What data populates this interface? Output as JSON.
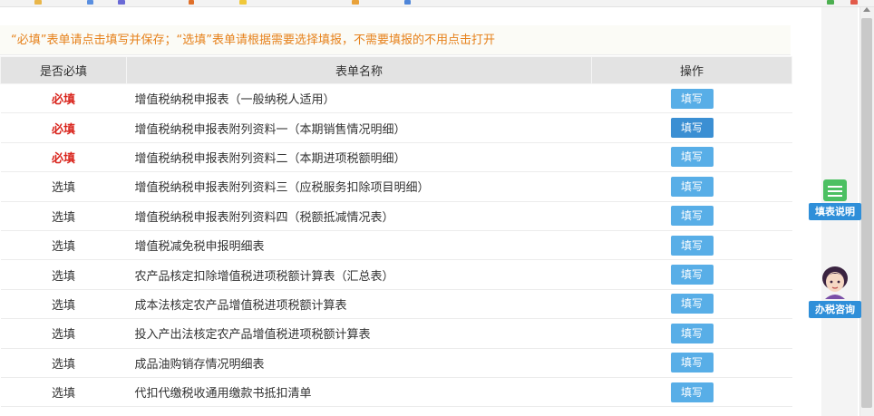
{
  "notice": "“必填”表单请点击填写并保存；“选填”表单请根据需要选择填报，不需要填报的不用点击打开",
  "table": {
    "headers": [
      "是否必填",
      "表单名称",
      "操作"
    ],
    "rows": [
      {
        "required": "必填",
        "name": "增值税纳税申报表（一般纳税人适用）",
        "action": "填写"
      },
      {
        "required": "必填",
        "name": "增值税纳税申报表附列资料一（本期销售情况明细）",
        "action": "填写"
      },
      {
        "required": "必填",
        "name": "增值税纳税申报表附列资料二（本期进项税额明细）",
        "action": "填写"
      },
      {
        "required": "选填",
        "name": "增值税纳税申报表附列资料三（应税服务扣除项目明细）",
        "action": "填写"
      },
      {
        "required": "选填",
        "name": "增值税纳税申报表附列资料四（税额抵减情况表）",
        "action": "填写"
      },
      {
        "required": "选填",
        "name": "增值税减免税申报明细表",
        "action": "填写"
      },
      {
        "required": "选填",
        "name": "农产品核定扣除增值税进项税额计算表（汇总表）",
        "action": "填写"
      },
      {
        "required": "选填",
        "name": "成本法核定农产品增值税进项税额计算表",
        "action": "填写"
      },
      {
        "required": "选填",
        "name": "投入产出法核定农产品增值税进项税额计算表",
        "action": "填写"
      },
      {
        "required": "选填",
        "name": "成品油购销存情况明细表",
        "action": "填写"
      },
      {
        "required": "选填",
        "name": "代扣代缴税收通用缴款书抵扣清单",
        "action": "填写"
      }
    ]
  },
  "widgets": {
    "form_help": "填表说明",
    "tax_consult": "办税咨询"
  },
  "colors": {
    "notice": "#e6811b",
    "required": "#d9251d",
    "button": "#58aee7",
    "widget_label": "#2f8fd9"
  },
  "icons": [
    "document-icon",
    "advisor-avatar-icon"
  ]
}
